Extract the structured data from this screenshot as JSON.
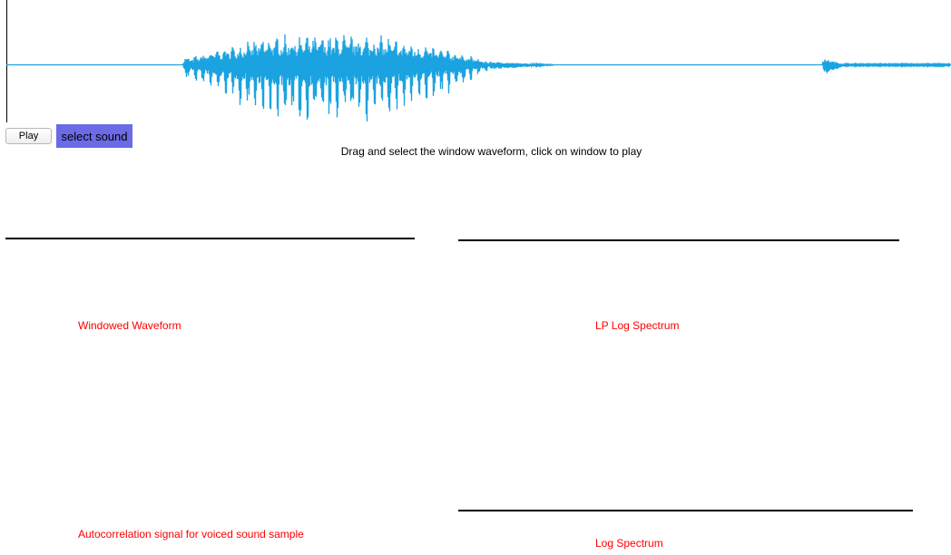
{
  "waveform": {
    "color": "#1aa3e0",
    "baseline_color": "#5bc3ec"
  },
  "controls": {
    "play_label": "Play",
    "select_sound_label": "select sound",
    "select_sound_color": "#6a6be5"
  },
  "instructions": "Drag and select the window waveform, click on window to play",
  "panels": {
    "windowed_waveform": "Windowed Waveform",
    "lp_log_spectrum": "LP Log Spectrum",
    "autocorrelation": "Autocorrelation signal for voiced sound sample",
    "log_spectrum": "Log Spectrum"
  }
}
